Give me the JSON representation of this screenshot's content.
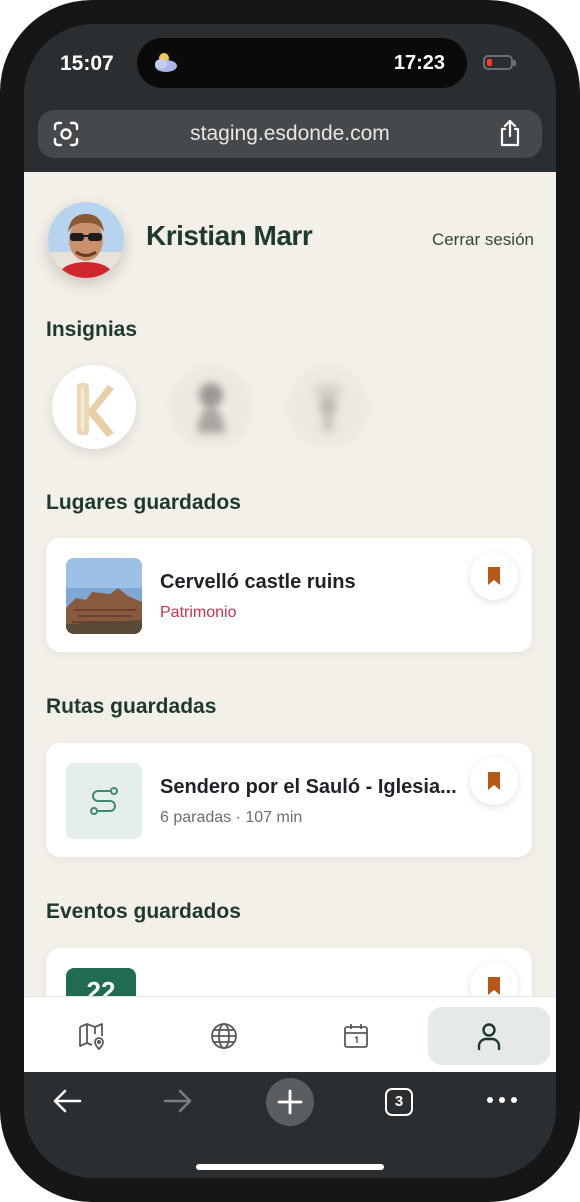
{
  "status_bar": {
    "time_left": "15:07",
    "time_right": "17:23"
  },
  "browser": {
    "url": "staging.esdonde.com",
    "tab_count": "3"
  },
  "profile": {
    "name": "Kristian Marr",
    "logout_label": "Cerrar sesión"
  },
  "sections": {
    "badges_title": "Insignias",
    "places_title": "Lugares guardados",
    "routes_title": "Rutas guardadas",
    "events_title": "Eventos guardados"
  },
  "saved_place": {
    "title": "Cervelló castle ruins",
    "category": "Patrimonio"
  },
  "saved_route": {
    "title": "Sendero por el Sauló - Iglesia...",
    "meta": "6 paradas · 107 min"
  },
  "saved_event": {
    "day": "22"
  },
  "colors": {
    "brand_green": "#1d3a2c",
    "accent_orange": "#b5591a",
    "category_red": "#c9344a",
    "page_bg": "#f3efe9"
  },
  "icons": [
    "weather-icon",
    "lens-icon",
    "share-icon",
    "bookmark-icon",
    "route-icon",
    "map-icon",
    "globe-icon",
    "calendar-icon",
    "user-icon",
    "back-icon",
    "forward-icon",
    "plus-icon",
    "tabs-icon",
    "more-icon"
  ]
}
